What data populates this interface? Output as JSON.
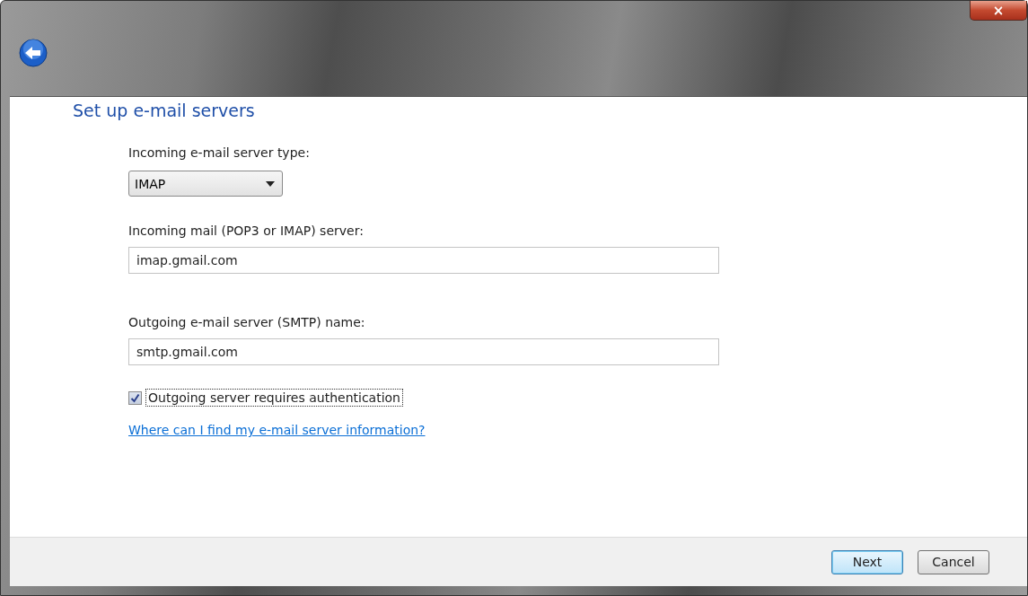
{
  "window": {
    "close_label": "×"
  },
  "heading": "Set up e-mail servers",
  "server_type": {
    "label": "Incoming e-mail server type:",
    "value": "IMAP"
  },
  "fields": [
    {
      "label": "Incoming mail (POP3 or IMAP) server:",
      "value": "imap.gmail.com"
    },
    {
      "label": "Outgoing e-mail server (SMTP) name:",
      "value": "smtp.gmail.com"
    }
  ],
  "auth": {
    "label": "Outgoing server requires authentication",
    "checked": true,
    "focused": true
  },
  "help_link": "Where can I find my e-mail server information?",
  "buttons": [
    {
      "label": "Next",
      "default": true
    },
    {
      "label": "Cancel",
      "default": false
    }
  ]
}
